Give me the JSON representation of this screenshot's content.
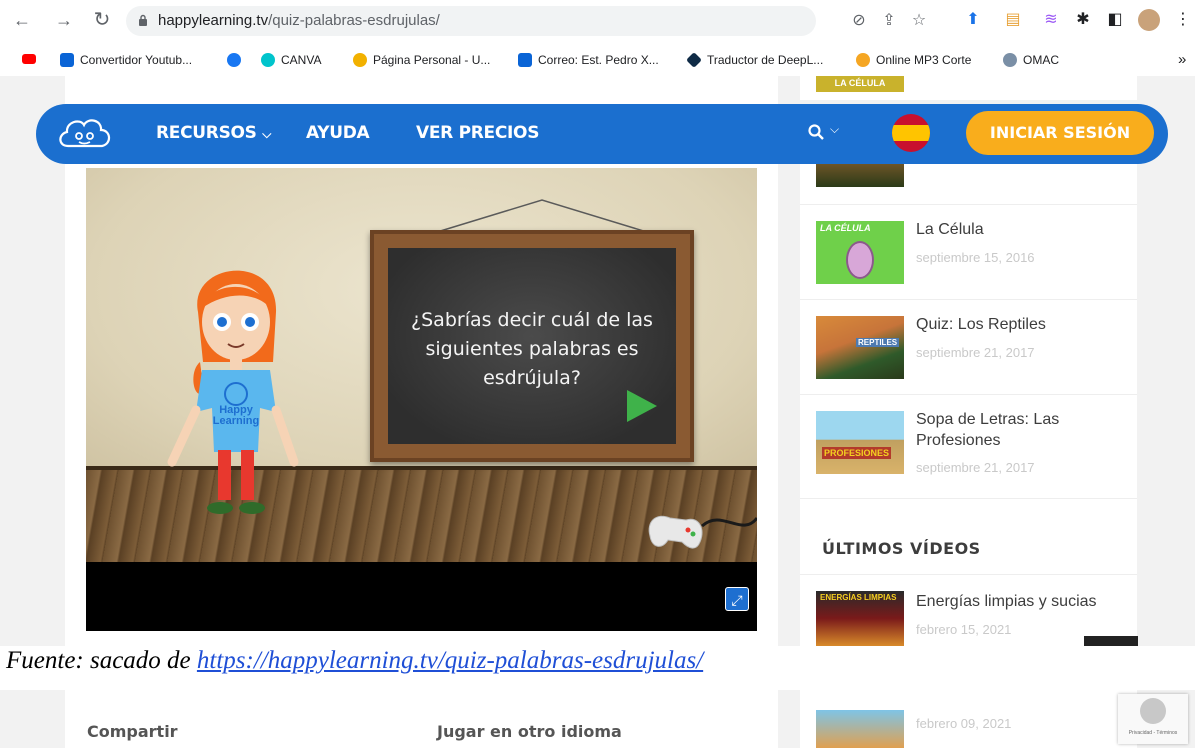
{
  "browser": {
    "url_host": "happylearning.tv",
    "url_path": "/quiz-palabras-esdrujulas/",
    "bookmarks": [
      {
        "label": "Convertidor Youtub...",
        "color": "#ff0000"
      },
      {
        "label": "CANVA",
        "color": "#00c4cc"
      },
      {
        "label": "Página Personal - U...",
        "color": "#f2b100"
      },
      {
        "label": "Correo: Est. Pedro X...",
        "color": "#0a64d6"
      },
      {
        "label": "Traductor de DeepL...",
        "color": "#0f2b46"
      },
      {
        "label": "Online MP3 Corte",
        "color": "#f5a623"
      },
      {
        "label": "OMAC",
        "color": "#7a8fa6"
      }
    ],
    "more_label": "»"
  },
  "navbar": {
    "items": [
      "RECURSOS",
      "AYUDA",
      "VER PRECIOS"
    ],
    "login_label": "INICIAR SESIÓN",
    "brand_color": "#1b6fcf",
    "accent_color": "#f9ad1c"
  },
  "game": {
    "question": "¿Sabrías decir cuál de las siguientes palabras es esdrújula?",
    "shirt_text": "Happy Learning"
  },
  "sidebar": {
    "top_thumb_label": "LA CÉLULA",
    "related": [
      {
        "title": "La Célula",
        "date": "septiembre 15, 2016",
        "thumb_text": "LA CÉLULA"
      },
      {
        "title": "Quiz: Los Reptiles",
        "date": "septiembre 21, 2017",
        "thumb_text": "REPTILES"
      },
      {
        "title": "Sopa de Letras: Las Profesiones",
        "date": "septiembre 21, 2017",
        "thumb_text": "PROFESIONES"
      }
    ],
    "latest_heading": "ÚLTIMOS VÍDEOS",
    "latest": [
      {
        "title": "Energías limpias y sucias",
        "date": "febrero 15, 2021",
        "thumb_text": "ENERGÍAS LIMPIAS"
      },
      {
        "title": "",
        "date": "febrero 09, 2021",
        "thumb_text": ""
      }
    ]
  },
  "caption": {
    "prefix": "Fuente: sacado de ",
    "link": "https://happylearning.tv/quiz-palabras-esdrujulas/"
  },
  "bottom": {
    "share_label": "Compartir",
    "other_lang_label": "Jugar en otro idioma",
    "recaptcha_text": "Privacidad - Términos"
  }
}
